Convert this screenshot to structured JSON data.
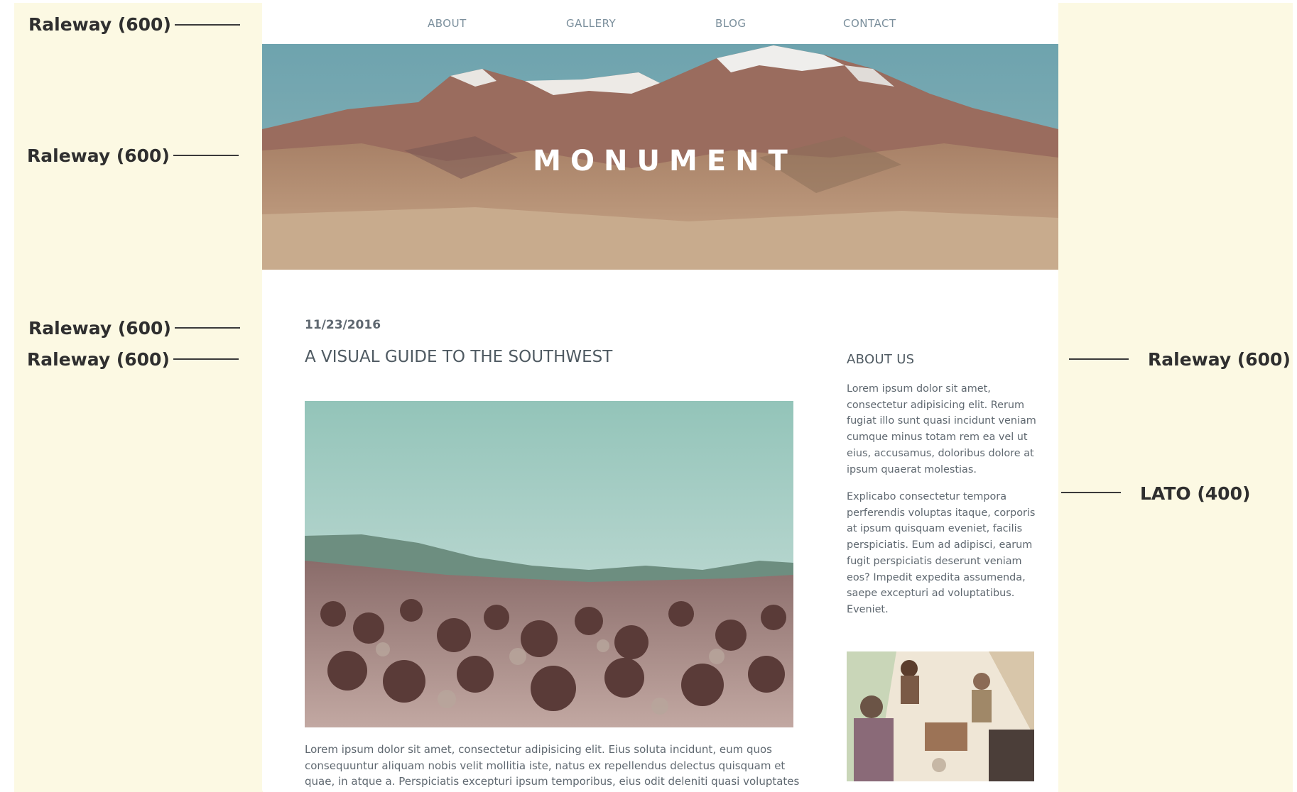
{
  "nav": {
    "items": [
      {
        "label": "ABOUT"
      },
      {
        "label": "GALLERY"
      },
      {
        "label": "BLOG"
      },
      {
        "label": "CONTACT"
      }
    ]
  },
  "hero": {
    "title": "MONUMENT"
  },
  "post": {
    "date": "11/23/2016",
    "title": "A VISUAL GUIDE TO THE SOUTHWEST",
    "body": "Lorem ipsum dolor sit amet, consectetur adipisicing elit. Eius soluta incidunt, eum quos consequuntur aliquam nobis velit mollitia iste, natus ex repellendus delectus quisquam et quae, in atque a. Perspiciatis excepturi ipsum temporibus, eius odit deleniti quasi voluptates"
  },
  "sidebar": {
    "heading": "ABOUT US",
    "paragraphs": [
      "Lorem ipsum dolor sit amet, consectetur adipisicing elit. Rerum fugiat illo sunt quasi incidunt veniam cumque minus totam rem ea vel ut eius, accusamus, doloribus dolore at ipsum quaerat molestias.",
      "Explicabo consectetur tempora perferendis voluptas itaque, corporis at ipsum quisquam eveniet, facilis perspiciatis. Eum ad adipisci, earum fugit perspiciatis deserunt veniam eos? Impedit expedita assumenda, saepe excepturi ad voluptatibus. Eveniet."
    ]
  },
  "annotations": {
    "nav_font": "Raleway (600)",
    "hero_font": "Raleway (600)",
    "date_font": "Raleway (600)",
    "title_font": "Raleway (600)",
    "sidebar_heading_font": "Raleway (600)",
    "body_font": "LATO (400)"
  },
  "colors": {
    "annotation_background": "#fcf9e3",
    "nav_text": "#7b8f9c",
    "heading_text": "#4f5a62",
    "body_text": "#5f6870"
  }
}
